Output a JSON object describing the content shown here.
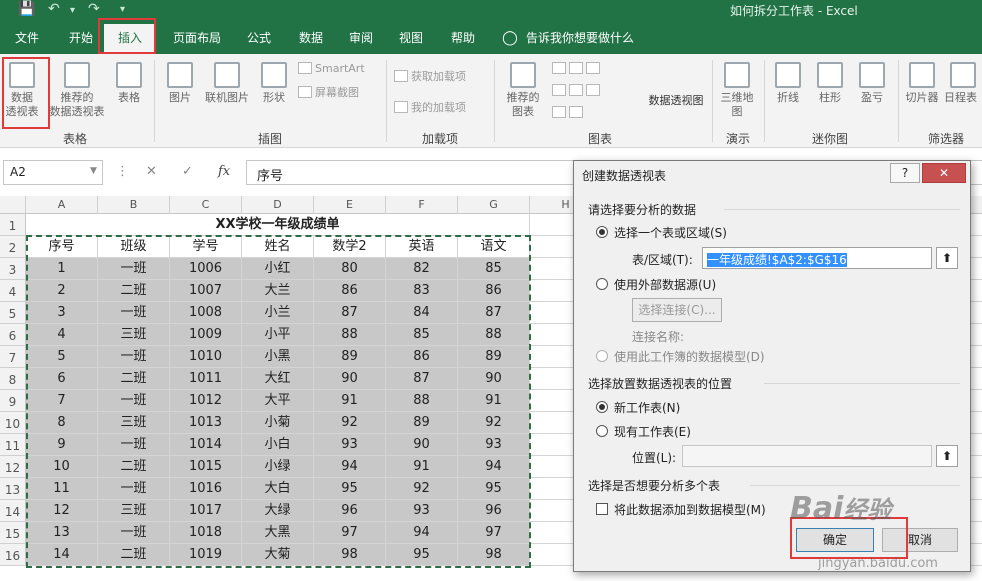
{
  "window": {
    "title": "如何拆分工作表 - Excel"
  },
  "qat": {
    "save_icon": "save-icon",
    "undo_icon": "undo-icon",
    "redo_icon": "redo-icon",
    "customize_icon": "chevron-down-icon"
  },
  "tabs": [
    "文件",
    "开始",
    "插入",
    "页面布局",
    "公式",
    "数据",
    "审阅",
    "视图",
    "帮助"
  ],
  "active_tab": "插入",
  "tell_me": "告诉我你想要做什么",
  "ribbon": {
    "pivot": "数据\n透视表",
    "recommended_pivot": "推荐的\n数据透视表",
    "table": "表格",
    "pictures": "图片",
    "online_pictures": "联机图片",
    "shapes": "形状",
    "smartart": "SmartArt",
    "screenshot": "屏幕截图",
    "get_addins": "获取加载项",
    "my_addins": "我的加载项",
    "recommended_charts": "推荐的\n图表",
    "pivot_chart": "数据透视图",
    "map3d": "三维地\n图",
    "line": "折线",
    "column": "柱形",
    "winloss": "盈亏",
    "slicer": "切片器",
    "timeline": "日程表",
    "groups": {
      "tables": "表格",
      "illustrations": "插图",
      "addins": "加载项",
      "charts": "图表",
      "tours": "演示",
      "sparklines": "迷你图",
      "filters": "筛选器"
    }
  },
  "formula_bar": {
    "name_box": "A2",
    "formula": "序号"
  },
  "sheet": {
    "columns": [
      "A",
      "B",
      "C",
      "D",
      "E",
      "F",
      "G",
      "H"
    ],
    "row_numbers": [
      "1",
      "2",
      "3",
      "4",
      "5",
      "6",
      "7",
      "8",
      "9",
      "10",
      "11",
      "12",
      "13",
      "14",
      "15",
      "16"
    ],
    "title": "XX学校一年级成绩单",
    "headers": [
      "序号",
      "班级",
      "学号",
      "姓名",
      "数学2",
      "英语",
      "语文"
    ],
    "rows": [
      [
        "1",
        "一班",
        "1006",
        "小红",
        "80",
        "82",
        "85"
      ],
      [
        "2",
        "二班",
        "1007",
        "大兰",
        "86",
        "83",
        "86"
      ],
      [
        "3",
        "一班",
        "1008",
        "小兰",
        "87",
        "84",
        "87"
      ],
      [
        "4",
        "三班",
        "1009",
        "小平",
        "88",
        "85",
        "88"
      ],
      [
        "5",
        "一班",
        "1010",
        "小黑",
        "89",
        "86",
        "89"
      ],
      [
        "6",
        "二班",
        "1011",
        "大红",
        "90",
        "87",
        "90"
      ],
      [
        "7",
        "一班",
        "1012",
        "大平",
        "91",
        "88",
        "91"
      ],
      [
        "8",
        "三班",
        "1013",
        "小菊",
        "92",
        "89",
        "92"
      ],
      [
        "9",
        "一班",
        "1014",
        "小白",
        "93",
        "90",
        "93"
      ],
      [
        "10",
        "二班",
        "1015",
        "小绿",
        "94",
        "91",
        "94"
      ],
      [
        "11",
        "一班",
        "1016",
        "大白",
        "95",
        "92",
        "95"
      ],
      [
        "12",
        "三班",
        "1017",
        "大绿",
        "96",
        "93",
        "96"
      ],
      [
        "13",
        "一班",
        "1018",
        "大黑",
        "97",
        "94",
        "97"
      ],
      [
        "14",
        "二班",
        "1019",
        "大菊",
        "98",
        "95",
        "98"
      ]
    ]
  },
  "dialog": {
    "title": "创建数据透视表",
    "help": "?",
    "close": "✕",
    "section_data": "请选择要分析的数据",
    "opt_range": "选择一个表或区域(S)",
    "range_label": "表/区域(T):",
    "range_value": "一年级成绩!$A$2:$G$16",
    "opt_external": "使用外部数据源(U)",
    "choose_conn": "选择连接(C)...",
    "conn_name": "连接名称:",
    "opt_model": "使用此工作簿的数据模型(D)",
    "section_place": "选择放置数据透视表的位置",
    "opt_new": "新工作表(N)",
    "opt_existing": "现有工作表(E)",
    "location_label": "位置(L):",
    "location_value": "",
    "section_multi": "选择是否想要分析多个表",
    "add_model": "将此数据添加到数据模型(M)",
    "ok": "确定",
    "cancel": "取消"
  },
  "watermark": {
    "brand": "Bai",
    "brand2": "经验",
    "url": "jingyan.baidu.com"
  }
}
